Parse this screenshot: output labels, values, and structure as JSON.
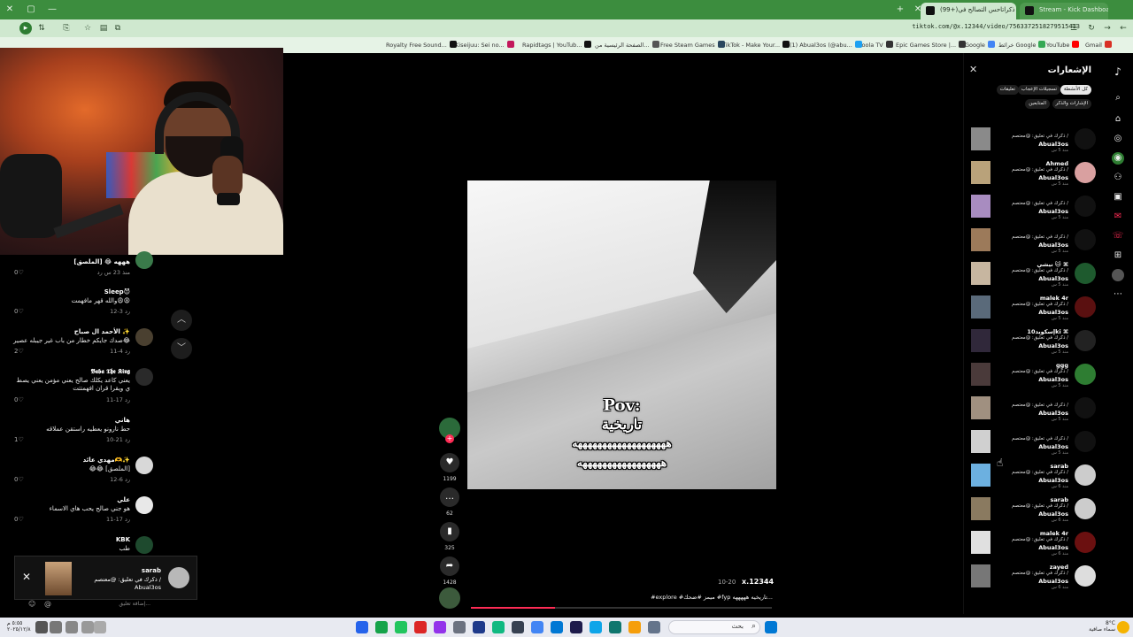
{
  "browser": {
    "tabs": [
      {
        "label": "Stream - Kick Dashboard",
        "active": false
      },
      {
        "label": "(99+)ذكراتاحس التصالح في",
        "active": true
      }
    ],
    "url": "tiktok.com/@x.12344/video/7563372518279515413",
    "bookmarks": [
      "Gmail",
      "YouTube",
      "خرائط Google",
      "Google",
      "Epic Games Store |...",
      "Loola TV",
      "(1) Abual3os (@abu...",
      "TikTok - Make Your...",
      "Free Steam Games",
      "الصفحة الرئيسية من...",
      "Rapidtags | YouTub...",
      "Kiseijuu: Sei no...",
      "Royalty Free Sound..."
    ]
  },
  "comments": [
    {
      "name": "هههه 😂 [الملصق]",
      "text": "",
      "meta": "منذ 23 س   رد",
      "likes": "0"
    },
    {
      "name": "Sleep😈",
      "text": "والله قهر مافهمت😩😩",
      "meta": "12-3   رد",
      "likes": "0"
    },
    {
      "name": "الأحمد ال صباح ✨",
      "text": "صدك جايكم خطار من باب غير جيبله عصير😂",
      "meta": "11-4   رد",
      "likes": "2"
    },
    {
      "name": "𝕭𝖆𝖇𝖆 𝕿𝖍𝖊 𝕶𝖎𝖓𝖌",
      "text": "يعني كاعد يكلك صالح يعني مؤمن يعني يصط ي ويقرا قران افهمتتت",
      "meta": "11-17   رد",
      "likes": "0"
    },
    {
      "name": "هاني",
      "text": "حط نارونو يعطيه راستقن عملاقه",
      "meta": "10-21   رد",
      "likes": "1"
    },
    {
      "name": "مهدي عائد🫶✨",
      "text": "😂😂 [الملصق]",
      "meta": "12-6   رد",
      "likes": "0"
    },
    {
      "name": "علي",
      "text": "هو جني صالح يحب هاي الاسماء",
      "meta": "11-17   رد",
      "likes": "0"
    },
    {
      "name": "KBK",
      "text": "طب",
      "meta": "",
      "likes": ""
    }
  ],
  "toast": {
    "name": "sarab",
    "message": "ذكرك في تعليق: @معتصم /",
    "user": "Abual3os"
  },
  "reply_placeholder": "إضافة تعليق...",
  "video": {
    "caption_pov": "Pov:",
    "caption_title": "تاريخية",
    "caption_laugh1": "هههههههههههههههههههه",
    "caption_laugh2": "هههههههههههههههههه",
    "author": "x.12344",
    "date": "10-20",
    "description": "#explore #ميمز #ضحك #fyp تاريخيه هههههه...",
    "progress": 0.28
  },
  "actions": {
    "likes": "1199",
    "comments": "62",
    "saves": "325",
    "shares": "1428"
  },
  "notifications": {
    "title": "الإشعارات",
    "filters_row1": [
      "كل الأنشطة",
      "تسجيلات الإعجاب",
      "تعليقات"
    ],
    "filters_row2": [
      "الإشارات والذكر",
      "المتابعين"
    ],
    "items": [
      {
        "name": "",
        "line": "ذكرك في تعليق: @معتصم /",
        "user": "Abual3os",
        "ago": "منذ 5 س"
      },
      {
        "name": "Ahmed",
        "line": "ذكرك في تعليق: @معتصم /",
        "user": "Abual3os",
        "ago": "منذ 5 س"
      },
      {
        "name": "",
        "line": "ذكرك في تعليق: @معتصم /",
        "user": "Abual3os",
        "ago": "منذ 5 س"
      },
      {
        "name": "",
        "line": "ذكرك في تعليق: @معتصم /",
        "user": "Abual3os",
        "ago": "منذ 5 س"
      },
      {
        "name": "نيشي 🐱 ⌘",
        "line": "ذكرك في تعليق: @معتصم /",
        "user": "Abual3os",
        "ago": "منذ 5 س"
      },
      {
        "name": "malek 4r",
        "line": "ذكرك في تعليق: @معتصم /",
        "user": "Abual3os",
        "ago": "منذ 5 س"
      },
      {
        "name": "إسكويد10ki ⌘",
        "line": "ذكرك في تعليق: @معتصم /",
        "user": "Abual3os",
        "ago": "منذ 5 س"
      },
      {
        "name": "ggg",
        "line": "ذكرك في تعليق: @معتصم /",
        "user": "Abual3os",
        "ago": "منذ 5 س"
      },
      {
        "name": "",
        "line": "ذكرك في تعليق: @معتصم /",
        "user": "Abual3os",
        "ago": "منذ 5 س"
      },
      {
        "name": "",
        "line": "ذكرك في تعليق: @معتصم /",
        "user": "Abual3os",
        "ago": "منذ 5 س"
      },
      {
        "name": "sarab",
        "line": "ذكرك في تعليق: @معتصم /",
        "user": "Abual3os",
        "ago": "منذ 6 س"
      },
      {
        "name": "sarab",
        "line": "ذكرك في تعليق: @معتصم /",
        "user": "Abual3os",
        "ago": "منذ 6 س"
      },
      {
        "name": "malek 4r",
        "line": "ذكرك في تعليق: @معتصم /",
        "user": "Abual3os",
        "ago": "منذ 6 س"
      },
      {
        "name": "zayed",
        "line": "ذكرك في تعليق: @معتصم /",
        "user": "Abual3os",
        "ago": "منذ 6 س"
      }
    ]
  },
  "taskbar": {
    "search": "بحث",
    "time": "٥:٥٥ م",
    "date": "٢٠٢٥/١٢/٨",
    "weather_temp": "8°C",
    "weather_desc": "سماء صافية"
  },
  "colors": {
    "accent": "#fe2c55",
    "browser_frame": "#3c8d3e",
    "taskbar": "#e8eaf1"
  }
}
